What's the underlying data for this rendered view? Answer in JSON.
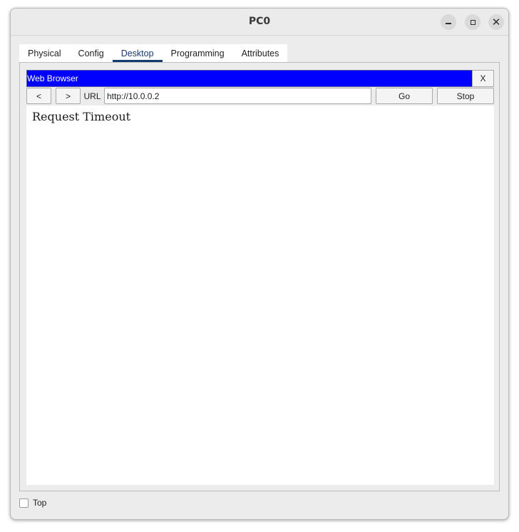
{
  "window": {
    "title": "PC0",
    "controls": {
      "minimize_icon": "minimize-icon",
      "maximize_icon": "maximize-icon",
      "close_icon": "close-icon",
      "close_glyph": "✕"
    }
  },
  "tabs": [
    {
      "label": "Physical",
      "active": false
    },
    {
      "label": "Config",
      "active": false
    },
    {
      "label": "Desktop",
      "active": true
    },
    {
      "label": "Programming",
      "active": false
    },
    {
      "label": "Attributes",
      "active": false
    }
  ],
  "browser": {
    "title": "Web Browser",
    "close_label": "X",
    "back_label": "<",
    "forward_label": ">",
    "url_label": "URL",
    "url_value": "http://10.0.0.2",
    "go_label": "Go",
    "stop_label": "Stop",
    "page_text": "Request Timeout",
    "header_color": "#0000ff"
  },
  "footer": {
    "top_label": "Top",
    "top_checked": false
  }
}
